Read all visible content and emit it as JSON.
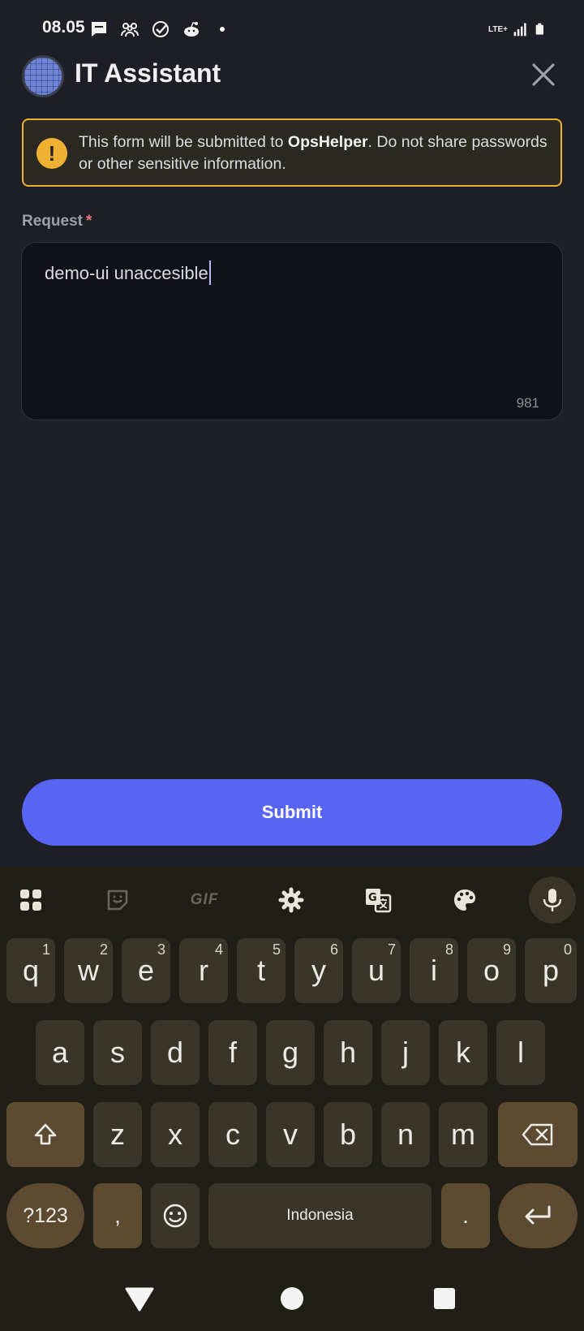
{
  "status_bar": {
    "time": "08.05",
    "network": "LTE+"
  },
  "header": {
    "title": "IT Assistant"
  },
  "warning": {
    "text_before": "This form will be submitted to ",
    "bot_name": "OpsHelper",
    "text_after": ". Do not share passwords or other sensitive information."
  },
  "form": {
    "label": "Request",
    "required_mark": "*",
    "value": "demo-ui unaccesible",
    "remaining_chars": "981",
    "submit_label": "Submit"
  },
  "keyboard": {
    "toolbar": {
      "gif_label": "GIF"
    },
    "row1": [
      {
        "key": "q",
        "hint": "1"
      },
      {
        "key": "w",
        "hint": "2"
      },
      {
        "key": "e",
        "hint": "3"
      },
      {
        "key": "r",
        "hint": "4"
      },
      {
        "key": "t",
        "hint": "5"
      },
      {
        "key": "y",
        "hint": "6"
      },
      {
        "key": "u",
        "hint": "7"
      },
      {
        "key": "i",
        "hint": "8"
      },
      {
        "key": "o",
        "hint": "9"
      },
      {
        "key": "p",
        "hint": "0"
      }
    ],
    "row2": [
      "a",
      "s",
      "d",
      "f",
      "g",
      "h",
      "j",
      "k",
      "l"
    ],
    "row3": [
      "z",
      "x",
      "c",
      "v",
      "b",
      "n",
      "m"
    ],
    "symbols_label": "?123",
    "comma_label": ",",
    "space_label": "Indonesia",
    "period_label": "."
  },
  "colors": {
    "accent": "#5865f2",
    "warning": "#f0b132",
    "background": "#1e1f26",
    "keyboard_bg": "#211e18"
  }
}
